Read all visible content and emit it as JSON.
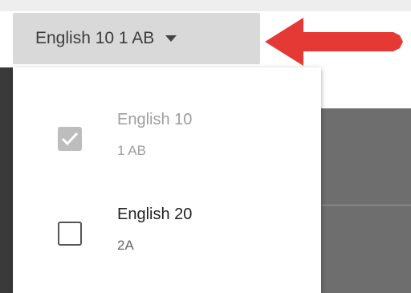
{
  "selector": {
    "label": "English 10 1 AB",
    "icon": "caret-down-icon"
  },
  "annotation": {
    "icon": "red-arrow-icon",
    "color": "#e53935"
  },
  "dropdown": {
    "options": [
      {
        "title": "English 10",
        "subtitle": "1 AB",
        "checked": true
      },
      {
        "title": "English 20",
        "subtitle": "2A",
        "checked": false
      }
    ]
  }
}
